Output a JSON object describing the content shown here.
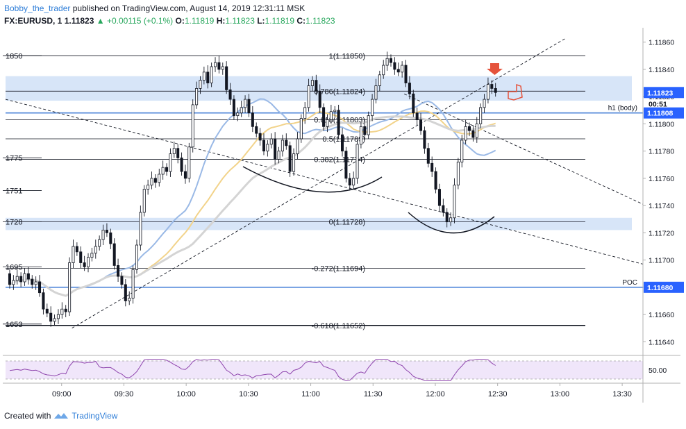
{
  "header": {
    "author": "Bobby_the_trader",
    "published_text": "published on TradingView.com, August 14, 2019 12:31:11 MSK",
    "symbol": "FX:EURUSD, 1",
    "last": "1.11823",
    "change": "+0.00115 (+0.1%)",
    "o_label": "O:",
    "o_value": "1.11819",
    "h_label": "H:",
    "h_value": "1.11823",
    "l_label": "L:",
    "l_value": "1.11819",
    "c_label": "C:",
    "c_value": "1.11823"
  },
  "footer": {
    "created_with": "Created with",
    "brand": "TradingView"
  },
  "colors": {
    "up": "#131722",
    "down": "#131722",
    "zone": "#c9dcf5",
    "blue_line": "#4f86d9",
    "ma_blue": "#9ab9e6",
    "ma_yellow": "#f2d38a",
    "ma_gray": "#d4d4d4",
    "rsi_bg": "#f0e6fa",
    "rsi_line": "#8e44ad",
    "price_badge": "#2962ff"
  },
  "chart_data": {
    "type": "candlestick",
    "x_ticks": [
      "09:00",
      "09:30",
      "10:00",
      "10:30",
      "11:00",
      "11:30",
      "12:00",
      "12:30",
      "13:00",
      "13:30"
    ],
    "x_tick_times": [
      540,
      570,
      600,
      630,
      660,
      690,
      720,
      750,
      780,
      810
    ],
    "y_ticks": [
      "1.11860",
      "1.11840",
      "1.11820",
      "1.11800",
      "1.11780",
      "1.11760",
      "1.11740",
      "1.11720",
      "1.11700",
      "1.11680",
      "1.11660",
      "1.11640"
    ],
    "y_tick_values": [
      1.1186,
      1.1184,
      1.1182,
      1.118,
      1.1178,
      1.1176,
      1.1174,
      1.1172,
      1.117,
      1.1168,
      1.1166,
      1.1164
    ],
    "ylim": [
      1.11632,
      1.11868
    ],
    "xlim": [
      513,
      820
    ],
    "left_level_labels": [
      {
        "label": "1850",
        "value": 1.1185
      },
      {
        "label": "1775",
        "value": 1.11775
      },
      {
        "label": "1751",
        "value": 1.11751
      },
      {
        "label": "1728",
        "value": 1.11728
      },
      {
        "label": "1695",
        "value": 1.11695
      },
      {
        "label": "1653",
        "value": 1.11653
      }
    ],
    "fib_levels": [
      {
        "label": "1(1.11850)",
        "value": 1.1185
      },
      {
        "label": "0.786(1.11824)",
        "value": 1.11824
      },
      {
        "label": "0.618(1.11803)",
        "value": 1.11803
      },
      {
        "label": "0.5(1.11789)",
        "value": 1.11789
      },
      {
        "label": "0.382(1.11774)",
        "value": 1.11774
      },
      {
        "label": "0(1.11728)",
        "value": 1.11728
      },
      {
        "label": "-0.272(1.11694)",
        "value": 1.11694
      },
      {
        "label": "-0.618(1.11652)",
        "value": 1.11652
      }
    ],
    "zones": [
      {
        "from": 1.11817,
        "to": 1.11835
      },
      {
        "from": 1.11722,
        "to": 1.11731
      }
    ],
    "horizontal_blue_lines": [
      {
        "value": 1.11808,
        "label": "h1 (body)",
        "badge": "1.11808"
      },
      {
        "value": 1.1168,
        "label": "POC",
        "badge": "1.11680"
      }
    ],
    "last_price": {
      "badge": "1.11823",
      "countdown": "00:51",
      "value": 1.11823
    },
    "closes": [
      1.11682,
      1.11685,
      1.11688,
      1.11684,
      1.1169,
      1.11686,
      1.11682,
      1.11684,
      1.11676,
      1.11664,
      1.11661,
      1.11655,
      1.11657,
      1.1166,
      1.11664,
      1.11662,
      1.11698,
      1.1171,
      1.11706,
      1.11698,
      1.11695,
      1.11702,
      1.11705,
      1.1171,
      1.11715,
      1.11722,
      1.1172,
      1.11712,
      1.11696,
      1.11688,
      1.11682,
      1.1167,
      1.11672,
      1.11693,
      1.11711,
      1.11735,
      1.11752,
      1.11755,
      1.1176,
      1.11757,
      1.11763,
      1.11768,
      1.11765,
      1.11778,
      1.11782,
      1.11775,
      1.11765,
      1.1176,
      1.11783,
      1.11814,
      1.11826,
      1.11832,
      1.11838,
      1.1183,
      1.11842,
      1.11845,
      1.1184,
      1.11842,
      1.11825,
      1.11818,
      1.11806,
      1.11808,
      1.11812,
      1.11818,
      1.11808,
      1.11798,
      1.11793,
      1.11788,
      1.1178,
      1.11785,
      1.11789,
      1.11774,
      1.1178,
      1.11788,
      1.11784,
      1.11765,
      1.11778,
      1.11789,
      1.11804,
      1.11812,
      1.11828,
      1.11832,
      1.11824,
      1.11812,
      1.11798,
      1.11803,
      1.11809,
      1.1181,
      1.11792,
      1.1178,
      1.1176,
      1.11755,
      1.1176,
      1.11785,
      1.11798,
      1.11792,
      1.11806,
      1.11818,
      1.11828,
      1.11836,
      1.11843,
      1.11848,
      1.11845,
      1.1184,
      1.11838,
      1.11843,
      1.1183,
      1.11822,
      1.11808,
      1.11803,
      1.11795,
      1.11782,
      1.11771,
      1.11765,
      1.11752,
      1.1174,
      1.11735,
      1.11728,
      1.11731,
      1.11755,
      1.11772,
      1.11788,
      1.11798,
      1.11795,
      1.1179,
      1.118,
      1.11812,
      1.11818,
      1.11829,
      1.11826,
      1.11823
    ]
  },
  "rsi": {
    "level_label": "50.00",
    "level": 50
  }
}
